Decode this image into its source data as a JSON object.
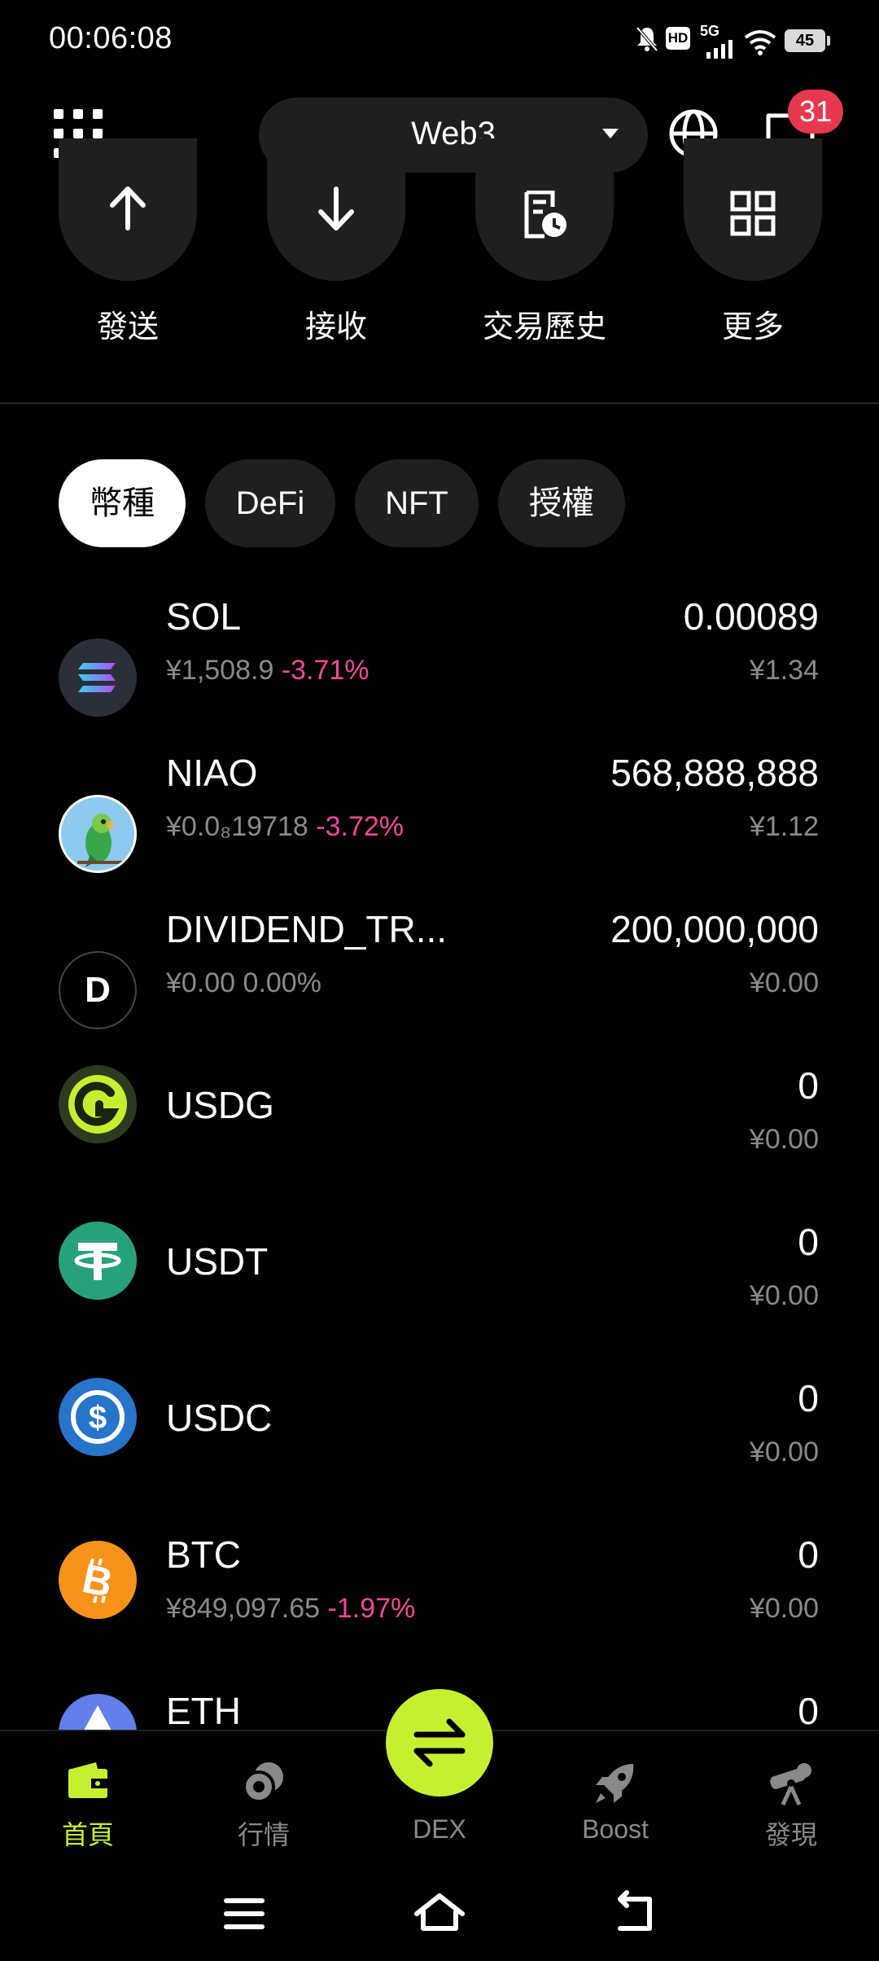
{
  "status_bar": {
    "time": "00:06:08",
    "hd": "HD",
    "network": "5G",
    "battery": "45"
  },
  "header": {
    "network_label": "Web3",
    "message_badge": "31"
  },
  "quick_actions": [
    {
      "label": "發送",
      "icon": "arrow-up-icon"
    },
    {
      "label": "接收",
      "icon": "arrow-down-icon"
    },
    {
      "label": "交易歷史",
      "icon": "history-icon"
    },
    {
      "label": "更多",
      "icon": "grid-icon"
    }
  ],
  "tabs": [
    {
      "label": "幣種",
      "active": true
    },
    {
      "label": "DeFi",
      "active": false
    },
    {
      "label": "NFT",
      "active": false
    },
    {
      "label": "授權",
      "active": false
    }
  ],
  "assets": [
    {
      "name": "SOL",
      "price": "¥1,508.9",
      "change": "-3.71%",
      "amount": "0.00089",
      "value": "¥1.34"
    },
    {
      "name": "NIAO",
      "price": "¥0.0₈19718",
      "change": "-3.72%",
      "amount": "568,888,888",
      "value": "¥1.12"
    },
    {
      "name": "DIVIDEND_TR...",
      "price": "¥0.00",
      "change": "0.00%",
      "amount": "200,000,000",
      "value": "¥0.00"
    },
    {
      "name": "USDG",
      "price": "",
      "change": "",
      "amount": "0",
      "value": "¥0.00"
    },
    {
      "name": "USDT",
      "price": "",
      "change": "",
      "amount": "0",
      "value": "¥0.00"
    },
    {
      "name": "USDC",
      "price": "",
      "change": "",
      "amount": "0",
      "value": "¥0.00"
    },
    {
      "name": "BTC",
      "price": "¥849,097.65",
      "change": "-1.97%",
      "amount": "0",
      "value": "¥0.00"
    },
    {
      "name": "ETH",
      "price": "",
      "change": "",
      "amount": "0",
      "value": ""
    }
  ],
  "dex_icon_letter": "D",
  "bottom_nav": [
    {
      "label": "首頁",
      "active": true
    },
    {
      "label": "行情",
      "active": false
    },
    {
      "label": "DEX",
      "active": false
    },
    {
      "label": "Boost",
      "active": false
    },
    {
      "label": "發現",
      "active": false
    }
  ],
  "colors": {
    "accent": "#c5f02f",
    "negative": "#f2479a",
    "badge": "#e63950"
  }
}
